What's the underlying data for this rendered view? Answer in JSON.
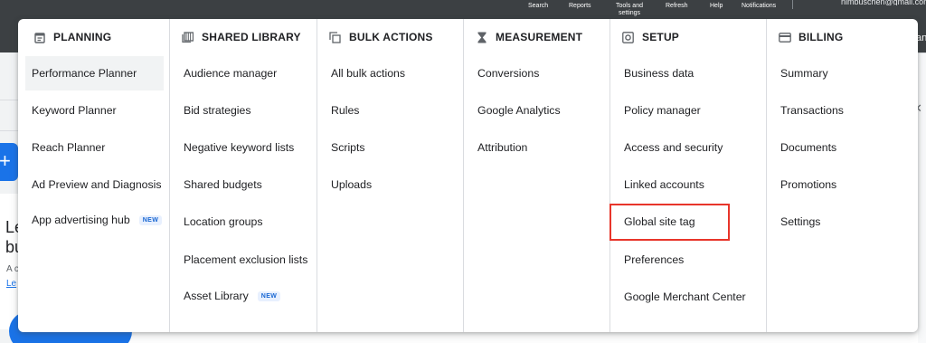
{
  "topbar": {
    "links": [
      "Search",
      "Reports",
      "Tools and settings",
      "Refresh",
      "Help",
      "Notifications"
    ],
    "account": "nimbuschen@gmail.com",
    "partial_text": "an"
  },
  "background": {
    "fab_glyph": "+",
    "heading_line1": "Le",
    "heading_line2": "bu",
    "small_text": "A c",
    "link_text": "Le",
    "close_glyph": "✕"
  },
  "menu": {
    "columns": [
      {
        "heading": "PLANNING",
        "icon": "calendar-icon",
        "items": [
          {
            "label": "Performance Planner",
            "selected": true
          },
          {
            "label": "Keyword Planner"
          },
          {
            "label": "Reach Planner"
          },
          {
            "label": "Ad Preview and Diagnosis"
          },
          {
            "label": "App advertising hub",
            "badge": "NEW"
          }
        ]
      },
      {
        "heading": "SHARED LIBRARY",
        "icon": "library-icon",
        "items": [
          {
            "label": "Audience manager"
          },
          {
            "label": "Bid strategies"
          },
          {
            "label": "Negative keyword lists"
          },
          {
            "label": "Shared budgets"
          },
          {
            "label": "Location groups"
          },
          {
            "label": "Placement exclusion lists"
          },
          {
            "label": "Asset Library",
            "badge": "NEW"
          }
        ]
      },
      {
        "heading": "BULK ACTIONS",
        "icon": "copy-icon",
        "items": [
          {
            "label": "All bulk actions"
          },
          {
            "label": "Rules"
          },
          {
            "label": "Scripts"
          },
          {
            "label": "Uploads"
          }
        ]
      },
      {
        "heading": "MEASUREMENT",
        "icon": "hourglass-icon",
        "items": [
          {
            "label": "Conversions"
          },
          {
            "label": "Google Analytics"
          },
          {
            "label": "Attribution"
          }
        ]
      },
      {
        "heading": "SETUP",
        "icon": "gear-icon",
        "items": [
          {
            "label": "Business data"
          },
          {
            "label": "Policy manager"
          },
          {
            "label": "Access and security"
          },
          {
            "label": "Linked accounts"
          },
          {
            "label": "Global site tag",
            "highlighted": true
          },
          {
            "label": "Preferences"
          },
          {
            "label": "Google Merchant Center"
          }
        ]
      },
      {
        "heading": "BILLING",
        "icon": "credit-card-icon",
        "items": [
          {
            "label": "Summary"
          },
          {
            "label": "Transactions"
          },
          {
            "label": "Documents"
          },
          {
            "label": "Promotions"
          },
          {
            "label": "Settings"
          }
        ]
      }
    ]
  },
  "colors": {
    "topbar": "#3c4043",
    "accent_blue": "#1a73e8",
    "highlight_red": "#e8352a",
    "selected_bg": "#f1f3f4",
    "badge_bg": "#e8f0fe",
    "badge_text": "#1967d2"
  }
}
